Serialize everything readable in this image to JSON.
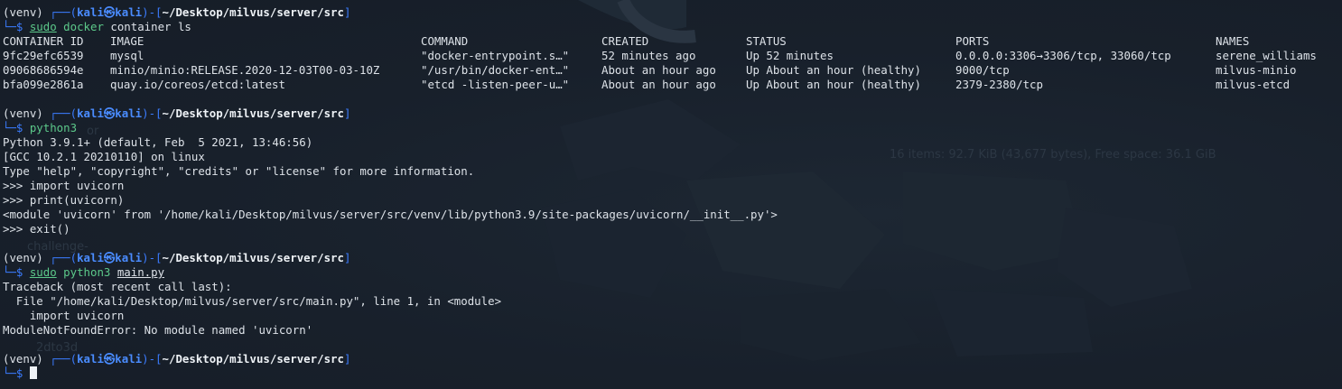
{
  "colors": {
    "background": "#18202b",
    "prompt_blue": "#3b7cff",
    "text": "#dde2e8",
    "command_green": "#5cc98a"
  },
  "prompt": {
    "venv": "(venv) ",
    "frame_open": "┌──(",
    "user_host": "kali㉿kali",
    "frame_mid": ")-[",
    "path": "~/Desktop/milvus/server/src",
    "frame_close": "]",
    "second_line": "└─$ "
  },
  "block1": {
    "cmd_sudo": "sudo",
    "cmd_docker": " docker",
    "cmd_rest": " container ls",
    "headers": [
      "CONTAINER ID",
      "IMAGE",
      "COMMAND",
      "CREATED",
      "STATUS",
      "PORTS",
      "NAMES"
    ],
    "rows": [
      [
        "9fc29efc6539",
        "mysql",
        "\"docker-entrypoint.s…\"",
        "52 minutes ago",
        "Up 52 minutes",
        "0.0.0.0:3306→3306/tcp, 33060/tcp",
        "serene_williams"
      ],
      [
        "09068686594e",
        "minio/minio:RELEASE.2020-12-03T00-03-10Z",
        "\"/usr/bin/docker-ent…\"",
        "About an hour ago",
        "Up About an hour (healthy)",
        "9000/tcp",
        "milvus-minio"
      ],
      [
        "bfa099e2861a",
        "quay.io/coreos/etcd:latest",
        "\"etcd -listen-peer-u…\"",
        "About an hour ago",
        "Up About an hour (healthy)",
        "2379-2380/tcp",
        "milvus-etcd"
      ]
    ]
  },
  "block2": {
    "cmd": "python3",
    "output": [
      "Python 3.9.1+ (default, Feb  5 2021, 13:46:56)",
      "[GCC 10.2.1 20210110] on linux",
      "Type \"help\", \"copyright\", \"credits\" or \"license\" for more information.",
      ">>> import uvicorn",
      ">>> print(uvicorn)",
      "<module 'uvicorn' from '/home/kali/Desktop/milvus/server/src/venv/lib/python3.9/site-packages/uvicorn/__init__.py'>",
      ">>> exit()"
    ]
  },
  "block3": {
    "cmd_sudo": "sudo",
    "cmd_python": " python3 ",
    "cmd_file": "main.py",
    "output": [
      "Traceback (most recent call last):",
      "  File \"/home/kali/Desktop/milvus/server/src/main.py\", line 1, in <module>",
      "    import uvicorn",
      "ModuleNotFoundError: No module named 'uvicorn'"
    ]
  },
  "background_text": {
    "file_info": "16 items: 92.7 KiB (43,677 bytes), Free space: 36.1 GiB",
    "folder_challenge": "challenge-",
    "folder_2dto3d": "2dto3d",
    "folder_for": "or"
  }
}
